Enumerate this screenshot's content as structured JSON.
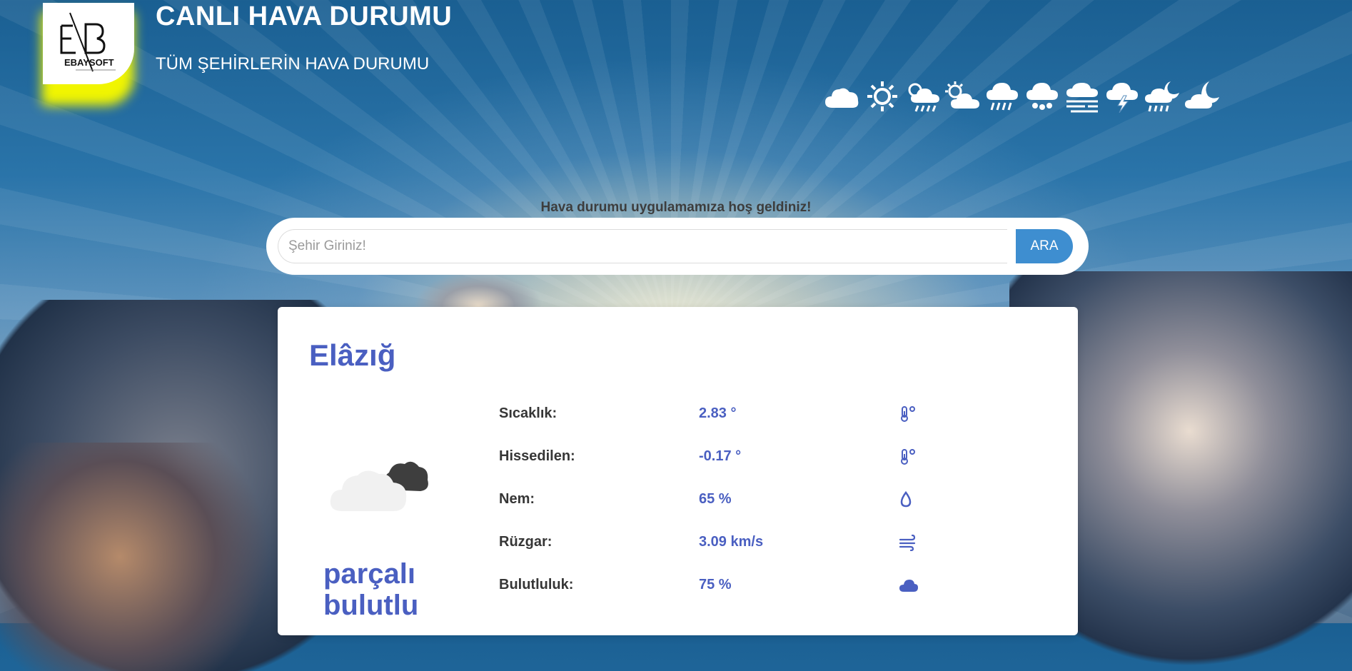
{
  "header": {
    "logo_alt": "EBAY SOFT",
    "logo_brand": "EBAYSOFT",
    "title": "CANLI HAVA DURUMU",
    "subtitle": "TÜM ŞEHİRLERİN HAVA DURUMU",
    "weather_icons": [
      "cloud-icon",
      "sun-icon",
      "sun-cloud-rain-icon",
      "sun-cloud-icon",
      "rain-icon",
      "hail-icon",
      "fog-icon",
      "thunder-icon",
      "night-rain-icon",
      "night-cloud-icon"
    ]
  },
  "search": {
    "welcome": "Hava durumu uygulamamıza hoş geldiniz!",
    "placeholder": "Şehir Giriniz!",
    "button_label": "ARA"
  },
  "weather": {
    "city": "Elâzığ",
    "description": "parçalı bulutlu",
    "details": [
      {
        "label": "Sıcaklık:",
        "value": "2.83 °",
        "icon": "thermometer-icon"
      },
      {
        "label": "Hissedilen:",
        "value": "-0.17 °",
        "icon": "thermometer-icon"
      },
      {
        "label": "Nem:",
        "value": "65 %",
        "icon": "droplet-icon"
      },
      {
        "label": "Rüzgar:",
        "value": "3.09 km/s",
        "icon": "wind-icon"
      },
      {
        "label": "Bulutluluk:",
        "value": "75 %",
        "icon": "cloud-icon"
      }
    ]
  },
  "colors": {
    "accent": "#4a5fc1",
    "button": "#3e8ed0",
    "logo_glow": "#f1f500"
  }
}
